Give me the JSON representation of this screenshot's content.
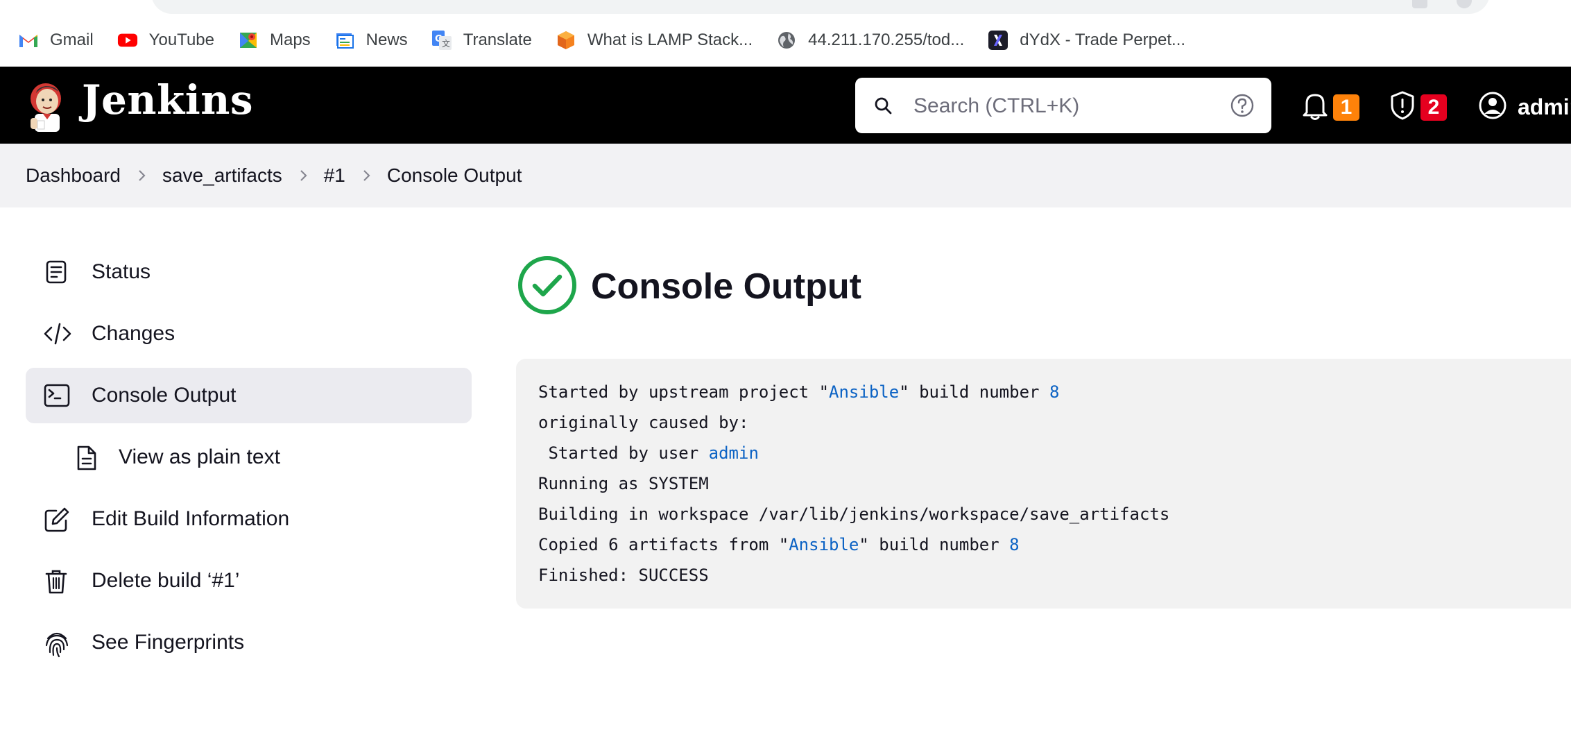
{
  "bookmarks": [
    {
      "label": "Gmail",
      "icon": "gmail-icon"
    },
    {
      "label": "YouTube",
      "icon": "youtube-icon"
    },
    {
      "label": "Maps",
      "icon": "maps-icon"
    },
    {
      "label": "News",
      "icon": "news-icon"
    },
    {
      "label": "Translate",
      "icon": "translate-icon"
    },
    {
      "label": "What is LAMP Stack...",
      "icon": "cube-icon"
    },
    {
      "label": "44.211.170.255/tod...",
      "icon": "globe-icon"
    },
    {
      "label": "dYdX - Trade Perpet...",
      "icon": "dydx-icon"
    }
  ],
  "header": {
    "brand": "Jenkins",
    "search_placeholder": "Search (CTRL+K)",
    "notifications_count": "1",
    "security_count": "2",
    "user_label": "admin",
    "colors": {
      "background": "#000000",
      "notification_badge": "#fe820a",
      "security_badge": "#e6001f"
    }
  },
  "breadcrumb": {
    "items": [
      "Dashboard",
      "save_artifacts",
      "#1",
      "Console Output"
    ]
  },
  "sidebar": {
    "items": [
      {
        "label": "Status",
        "icon": "notepad-icon"
      },
      {
        "label": "Changes",
        "icon": "code-icon"
      },
      {
        "label": "Console Output",
        "icon": "terminal-icon",
        "active": true
      },
      {
        "label": "View as plain text",
        "icon": "document-icon"
      },
      {
        "label": "Edit Build Information",
        "icon": "edit-icon"
      },
      {
        "label": "Delete build ‘#1’",
        "icon": "trash-icon"
      },
      {
        "label": "See Fingerprints",
        "icon": "fingerprint-icon"
      }
    ]
  },
  "main": {
    "title": "Console Output",
    "status": "success",
    "status_color": "#1ea64b",
    "console": {
      "line1": {
        "prefix": "Started by upstream project \"",
        "link": "Ansible",
        "middle": "\" build number ",
        "number": "8"
      },
      "line2": "originally caused by:",
      "line3": {
        "prefix": " Started by user ",
        "link": "admin"
      },
      "line4": "Running as SYSTEM",
      "line5": "Building in workspace /var/lib/jenkins/workspace/save_artifacts",
      "line6": {
        "prefix": "Copied 6 artifacts from \"",
        "link": "Ansible",
        "middle": "\" build number ",
        "number": "8"
      },
      "line7": "Finished: SUCCESS",
      "link_color": "#0b62c4"
    }
  }
}
